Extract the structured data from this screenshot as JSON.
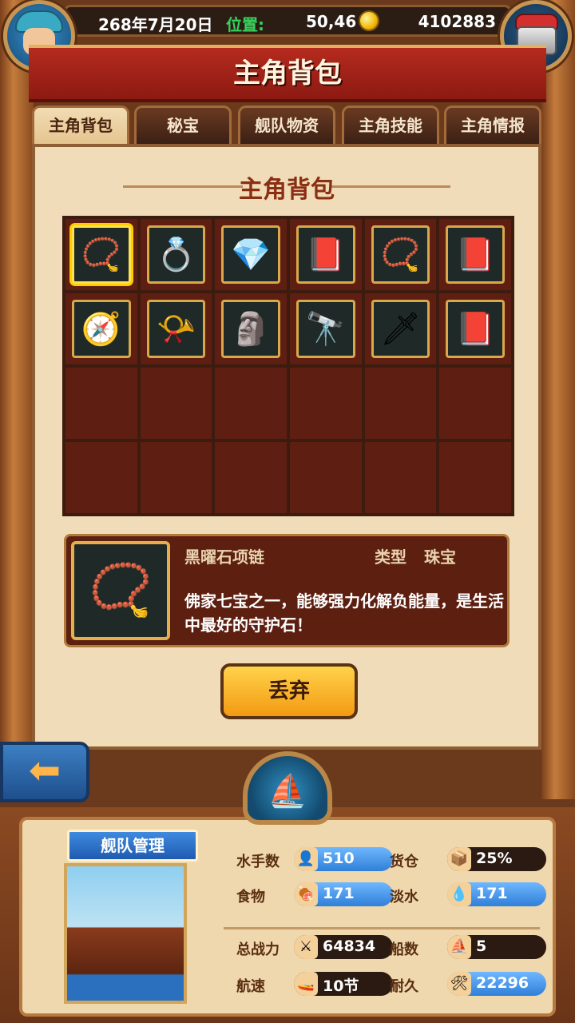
{
  "header": {
    "date": "268年7月20日",
    "position_label": "位置:",
    "position_value": "50,46",
    "money": "4102883",
    "avatar_icon": "pirate-avatar-icon",
    "chest_icon": "treasure-chest-icon"
  },
  "title": "主角背包",
  "tabs": [
    {
      "label": "主角背包",
      "active": true
    },
    {
      "label": "秘宝",
      "active": false
    },
    {
      "label": "舰队物资",
      "active": false
    },
    {
      "label": "主角技能",
      "active": false
    },
    {
      "label": "主角情报",
      "active": false
    }
  ],
  "panel_title": "主角背包",
  "inventory": [
    {
      "icon": "necklace-icon",
      "glyph": "📿",
      "selected": true
    },
    {
      "icon": "ring-icon",
      "glyph": "💍"
    },
    {
      "icon": "gem-icon",
      "glyph": "💎"
    },
    {
      "icon": "book-icon",
      "glyph": "📕"
    },
    {
      "icon": "bracelet-icon",
      "glyph": "📿"
    },
    {
      "icon": "book-icon",
      "glyph": "📕"
    },
    {
      "icon": "astrolabe-icon",
      "glyph": "🧭"
    },
    {
      "icon": "horn-icon",
      "glyph": "📯"
    },
    {
      "icon": "golden-statue-icon",
      "glyph": "🗿"
    },
    {
      "icon": "telescope-icon",
      "glyph": "🔭"
    },
    {
      "icon": "sword-icon",
      "glyph": "🗡"
    },
    {
      "icon": "book-icon",
      "glyph": "📕"
    }
  ],
  "detail": {
    "name": "黑曜石项链",
    "type_label": "类型",
    "type_value": "珠宝",
    "description": "佛家七宝之一，能够强力化解负能量，是生活中最好的守护石！"
  },
  "discard_label": "丢弃",
  "back_icon": "back-arrow-icon",
  "fleet": {
    "label": "舰队管理",
    "stats": [
      {
        "label": "水手数",
        "value": "510",
        "icon": "sailor-icon",
        "glyph": "👤",
        "bar": "blue"
      },
      {
        "label": "货仓",
        "value": "25%",
        "icon": "cargo-icon",
        "glyph": "📦",
        "bar": "dark"
      },
      {
        "label": "食物",
        "value": "171",
        "icon": "food-icon",
        "glyph": "🍖",
        "bar": "blue"
      },
      {
        "label": "淡水",
        "value": "171",
        "icon": "water-icon",
        "glyph": "💧",
        "bar": "blue"
      },
      {
        "label": "总战力",
        "value": "64834",
        "icon": "power-icon",
        "glyph": "⚔",
        "bar": "dark"
      },
      {
        "label": "船数",
        "value": "5",
        "icon": "ship-count-icon",
        "glyph": "⛵",
        "bar": "dark"
      },
      {
        "label": "航速",
        "value": "10节",
        "icon": "speed-icon",
        "glyph": "🚤",
        "bar": "dark"
      },
      {
        "label": "耐久",
        "value": "22296",
        "icon": "durability-icon",
        "glyph": "🛠",
        "bar": "blue"
      }
    ]
  }
}
